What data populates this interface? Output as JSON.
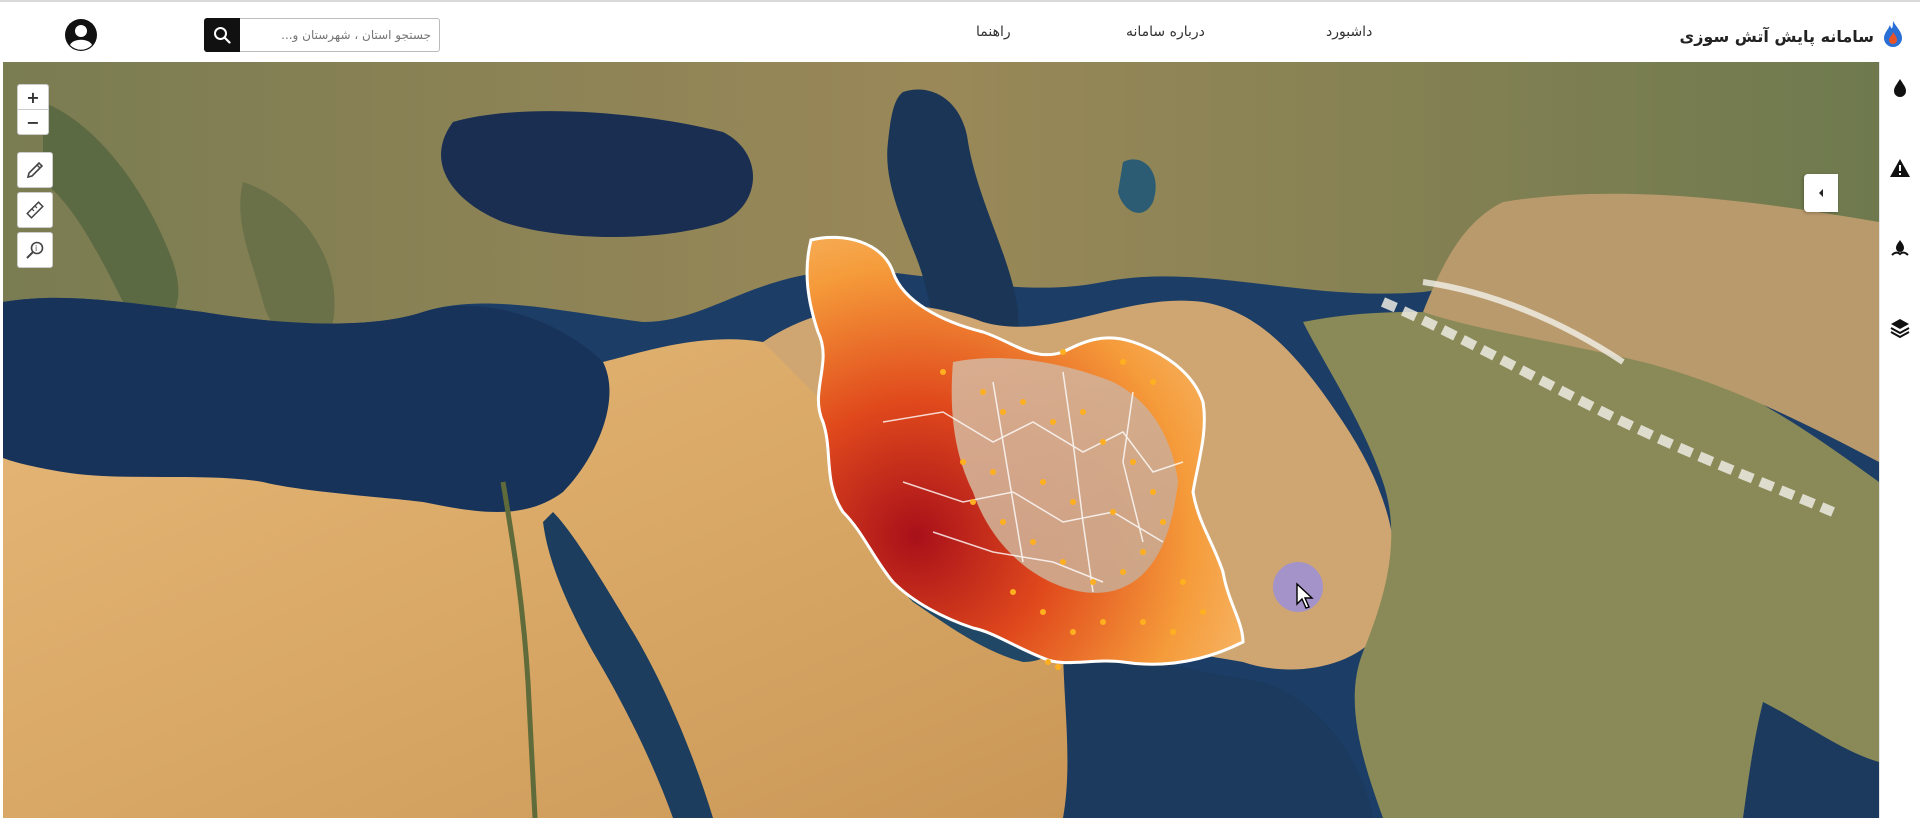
{
  "header": {
    "app_title": "سامانه پایش آتش سوزی",
    "nav": [
      "داشبورد",
      "درباره سامانه",
      "راهنما"
    ],
    "search_placeholder": "جستجو استان ، شهرستان و..."
  },
  "map_tools": {
    "zoom_in": "+",
    "zoom_out": "−",
    "tools": [
      "pencil-icon",
      "ruler-icon",
      "identify-icon"
    ]
  },
  "sidebar": {
    "icons": [
      "fire-drop-icon",
      "warning-icon",
      "fire-station-icon",
      "layers-icon"
    ],
    "collapse_icon": "chevron-left-icon"
  },
  "colors": {
    "brand_blue": "#2a6fd6",
    "fire_red": "#a8101a",
    "fire_orange": "#f07a20",
    "hotspot": "#ffb020",
    "sea": "#1c3e66"
  }
}
